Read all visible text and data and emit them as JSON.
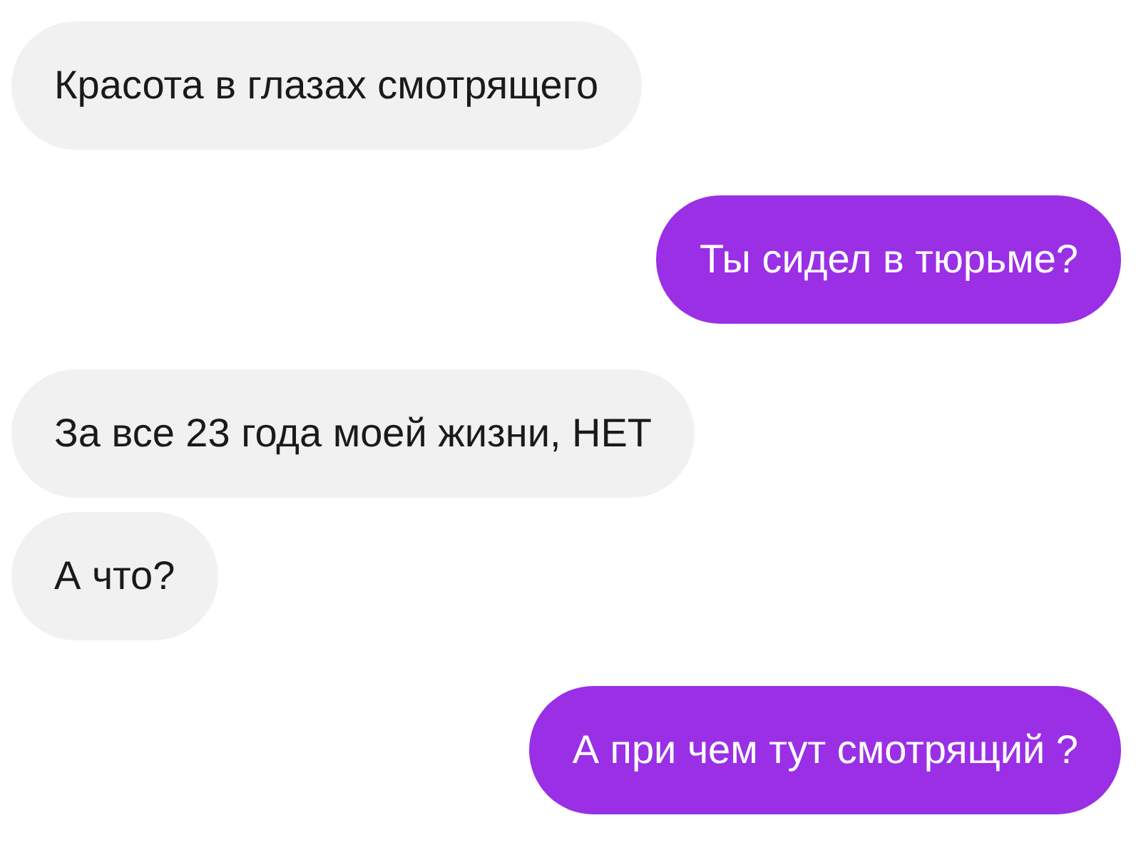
{
  "messages": [
    {
      "text": "Красота в глазах смотрящего",
      "kind": "received"
    },
    {
      "text": "Ты сидел в тюрьме?",
      "kind": "sent"
    },
    {
      "text": "За все 23 года моей жизни, НЕТ",
      "kind": "received"
    },
    {
      "text": "А что?",
      "kind": "received"
    },
    {
      "text": "А при чем тут смотрящий ?",
      "kind": "sent"
    }
  ]
}
